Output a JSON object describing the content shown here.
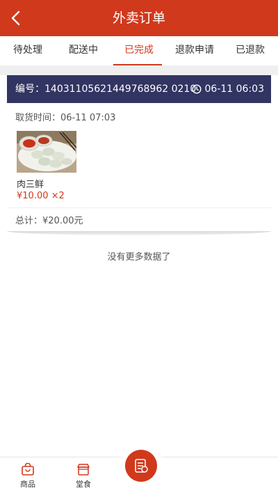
{
  "header": {
    "title": "外卖订单"
  },
  "tabs": [
    {
      "label": "待处理"
    },
    {
      "label": "配送中"
    },
    {
      "label": "已完成"
    },
    {
      "label": "退款申请"
    },
    {
      "label": "已退款"
    }
  ],
  "order": {
    "number": "编号：14031105621449768962 0210",
    "time": "06-11 06:03",
    "pickup": "取货时间：06-11 07:03",
    "item_name": "肉三鲜",
    "item_price": "¥10.00 ×2",
    "total": "总计：¥20.00元"
  },
  "list_end": "没有更多数据了",
  "bottom_nav": [
    {
      "label": "商品",
      "icon": "bag-icon"
    },
    {
      "label": "堂食",
      "icon": "store-icon"
    }
  ],
  "colors": {
    "primary": "#d0391c",
    "card_header": "#323462"
  }
}
